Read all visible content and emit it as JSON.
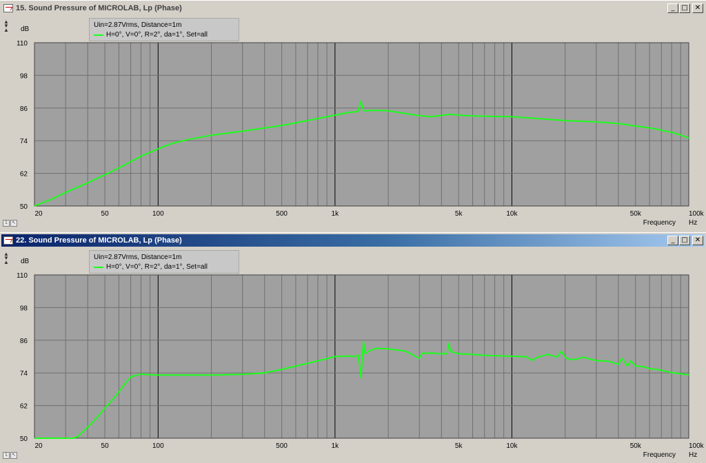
{
  "windows": [
    {
      "title": "15. Sound Pressure of MICROLAB, Lp (Phase)",
      "active": false,
      "legend": {
        "line1": "Uin=2.87Vrms, Distance=1m",
        "line2": "H=0°, V=0°, R=2°, da=1°, Set=all"
      },
      "y_unit": "dB",
      "x_unit": "Hz",
      "x_title": "Frequency"
    },
    {
      "title": "22. Sound Pressure of MICROLAB, Lp (Phase)",
      "active": true,
      "legend": {
        "line1": "Uin=2.87Vrms, Distance=1m",
        "line2": "H=0°, V=0°, R=2°, da=1°, Set=all"
      },
      "y_unit": "dB",
      "x_unit": "Hz",
      "x_title": "Frequency"
    }
  ],
  "window_buttons": {
    "minimize": "_",
    "maximize": "□",
    "close": "✕"
  },
  "colors": {
    "plot_bg": "#a0a0a0",
    "curve": "#1aff1a",
    "grid": "#6f6f6f",
    "grid_major": "#000000"
  },
  "chart_data": [
    {
      "type": "line",
      "title": "15. Sound Pressure of MICROLAB, Lp (Phase)",
      "xlabel": "Frequency",
      "xunit": "Hz",
      "ylabel": "dB",
      "xscale": "log",
      "xlim": [
        20,
        100000
      ],
      "ylim": [
        50,
        110
      ],
      "yticks": [
        50,
        62,
        74,
        86,
        98,
        110
      ],
      "xticks": [
        [
          20,
          "20"
        ],
        [
          50,
          "50"
        ],
        [
          100,
          "100"
        ],
        [
          500,
          "500"
        ],
        [
          1000,
          "1k"
        ],
        [
          5000,
          "5k"
        ],
        [
          10000,
          "10k"
        ],
        [
          50000,
          "50k"
        ],
        [
          100000,
          "100k"
        ]
      ],
      "grid": true,
      "series": [
        {
          "name": "H=0°, V=0°, R=2°, da=1°, Set=all",
          "x": [
            20,
            25,
            30,
            40,
            50,
            60,
            70,
            80,
            90,
            100,
            120,
            150,
            200,
            300,
            500,
            700,
            1000,
            1200,
            1350,
            1400,
            1450,
            1500,
            1600,
            2000,
            2500,
            3000,
            3500,
            4000,
            4500,
            5000,
            6000,
            8000,
            10000,
            15000,
            20000,
            30000,
            40000,
            50000,
            60000,
            70000,
            80000,
            90000,
            100000
          ],
          "y": [
            50,
            52.5,
            55,
            58.5,
            61.5,
            64,
            66.3,
            68.3,
            69.7,
            71,
            73,
            74.5,
            76,
            77.5,
            79.6,
            81.4,
            83.4,
            84.4,
            84.7,
            88.5,
            85.1,
            84.9,
            85.2,
            85,
            84,
            83.2,
            82.8,
            83.3,
            83.7,
            83.4,
            83.1,
            82.9,
            82.8,
            82,
            81.4,
            80.9,
            80.3,
            79.4,
            78.7,
            77.9,
            77.1,
            76.1,
            74.9
          ]
        }
      ]
    },
    {
      "type": "line",
      "title": "22. Sound Pressure of MICROLAB, Lp (Phase)",
      "xlabel": "Frequency",
      "xunit": "Hz",
      "ylabel": "dB",
      "xscale": "log",
      "xlim": [
        20,
        100000
      ],
      "ylim": [
        50,
        110
      ],
      "yticks": [
        50,
        62,
        74,
        86,
        98,
        110
      ],
      "xticks": [
        [
          20,
          "20"
        ],
        [
          50,
          "50"
        ],
        [
          100,
          "100"
        ],
        [
          500,
          "500"
        ],
        [
          1000,
          "1k"
        ],
        [
          5000,
          "5k"
        ],
        [
          10000,
          "10k"
        ],
        [
          50000,
          "50k"
        ],
        [
          100000,
          "100k"
        ]
      ],
      "grid": true,
      "series": [
        {
          "name": "H=0°, V=0°, R=2°, da=1°, Set=all",
          "x": [
            20,
            25,
            30,
            33,
            35,
            40,
            45,
            50,
            55,
            60,
            65,
            70,
            80,
            90,
            100,
            150,
            200,
            300,
            400,
            500,
            700,
            1000,
            1200,
            1300,
            1350,
            1380,
            1400,
            1420,
            1450,
            1480,
            1550,
            1700,
            2000,
            2500,
            2900,
            3000,
            3100,
            3500,
            4000,
            4300,
            4400,
            4500,
            4700,
            5000,
            6000,
            7000,
            8000,
            10000,
            12000,
            13000,
            14000,
            16000,
            18000,
            19000,
            20000,
            21000,
            23000,
            25000,
            30000,
            35000,
            40000,
            42000,
            45000,
            47000,
            50000,
            55000,
            60000,
            70000,
            80000,
            100000
          ],
          "y": [
            50,
            50,
            50,
            50,
            50.5,
            54,
            57.5,
            61,
            64,
            67,
            70,
            72.5,
            73.6,
            73.3,
            73.2,
            73.2,
            73.2,
            73.5,
            74,
            75.3,
            77.5,
            80,
            80.2,
            80,
            80.6,
            76.4,
            72.4,
            77.5,
            85.5,
            81,
            82,
            83,
            82.8,
            82,
            79.8,
            79.3,
            81.2,
            81.3,
            81,
            81,
            84.8,
            82,
            81.5,
            81,
            80.8,
            80.4,
            80.3,
            80.1,
            80,
            78.6,
            79.8,
            80.8,
            79.8,
            81.9,
            79.8,
            79,
            78.9,
            79.8,
            78.5,
            78.3,
            77.2,
            79.3,
            76.5,
            78.4,
            76.5,
            76.3,
            75.6,
            75,
            74.1,
            73.3
          ]
        }
      ]
    }
  ]
}
